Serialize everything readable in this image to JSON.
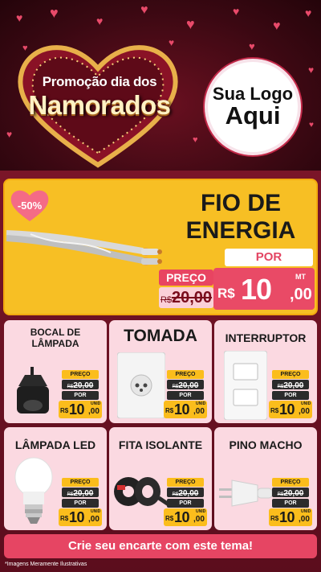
{
  "header": {
    "promo_line1": "Promoção dia dos",
    "promo_line2": "Namorados",
    "logo_line1": "Sua Logo",
    "logo_line2": "Aqui"
  },
  "hero": {
    "discount": "-50%",
    "title": "FIO DE ENERGIA",
    "por": "POR",
    "preco": "PREÇO",
    "old_currency": "R$",
    "old_price": "20,00",
    "currency": "R$",
    "price_int": "10",
    "price_cents": ",00",
    "unit": "MT"
  },
  "products": [
    {
      "name": "BOCAL DE LÂMPADA",
      "preco": "PREÇO",
      "old_currency": "R$",
      "old_price": "20,00",
      "por": "POR",
      "currency": "R$",
      "price_int": "10",
      "price_cents": ",00",
      "unit": "UNID"
    },
    {
      "name": "TOMADA",
      "preco": "PREÇO",
      "old_currency": "R$",
      "old_price": "20,00",
      "por": "POR",
      "currency": "R$",
      "price_int": "10",
      "price_cents": ",00",
      "unit": "UNID"
    },
    {
      "name": "INTERRUPTOR",
      "preco": "PREÇO",
      "old_currency": "R$",
      "old_price": "20,00",
      "por": "POR",
      "currency": "R$",
      "price_int": "10",
      "price_cents": ",00",
      "unit": "UNID"
    },
    {
      "name": "LÂMPADA LED",
      "preco": "PREÇO",
      "old_currency": "R$",
      "old_price": "20,00",
      "por": "POR",
      "currency": "R$",
      "price_int": "10",
      "price_cents": ",00",
      "unit": "UNID"
    },
    {
      "name": "FITA ISOLANTE",
      "preco": "PREÇO",
      "old_currency": "R$",
      "old_price": "20,00",
      "por": "POR",
      "currency": "R$",
      "price_int": "10",
      "price_cents": ",00",
      "unit": "UNID"
    },
    {
      "name": "PINO MACHO",
      "preco": "PREÇO",
      "old_currency": "R$",
      "old_price": "20,00",
      "por": "POR",
      "currency": "R$",
      "price_int": "10",
      "price_cents": ",00",
      "unit": "UNID"
    }
  ],
  "footer": {
    "cta": "Crie seu encarte com este tema!",
    "disclaimer": "*Imagens Meramente Ilustrativas"
  },
  "colors": {
    "background": "#3a0812",
    "accent_pink": "#e64563",
    "accent_yellow": "#fbbd1c",
    "card_bg": "#fbd9e1"
  },
  "icons": [
    "heart-icon",
    "lamp-socket-icon",
    "wall-outlet-icon",
    "light-switch-icon",
    "led-bulb-icon",
    "insulating-tape-icon",
    "male-plug-icon",
    "electric-cable-icon"
  ]
}
